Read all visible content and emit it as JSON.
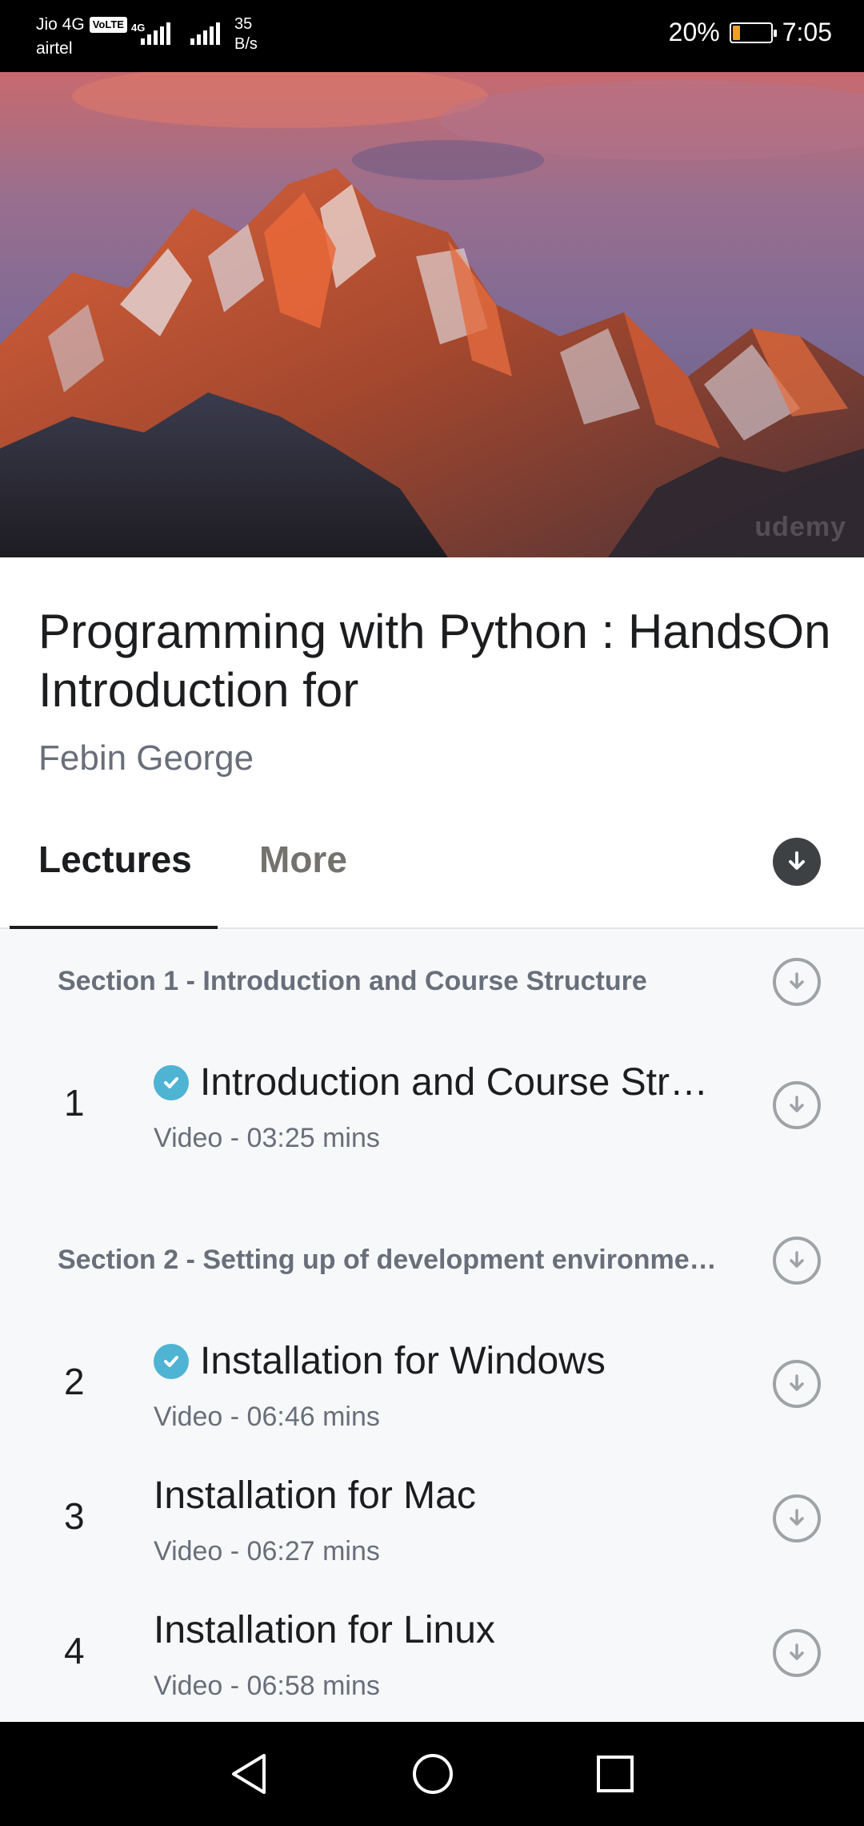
{
  "status_bar": {
    "carrier1": "Jio 4G",
    "volte": "VoLTE",
    "carrier2": "airtel",
    "network_type": "4G",
    "speed_value": "35",
    "speed_unit": "B/s",
    "battery": "20%",
    "time": "7:05",
    "battery_level_percent": 20,
    "battery_color": "#f0a020"
  },
  "hero": {
    "watermark": "udemy"
  },
  "course": {
    "title": "Programming with Python : HandsOn Introduction for",
    "instructor": "Febin George"
  },
  "tabs": {
    "lectures": "Lectures",
    "more": "More"
  },
  "sections": [
    {
      "title": "Section 1 - Introduction and Course Structure",
      "lectures": [
        {
          "number": "1",
          "title": "Introduction and Course Stru…",
          "meta": "Video - 03:25 mins",
          "completed": true
        }
      ]
    },
    {
      "title": "Section 2 - Setting up of development environmen…",
      "lectures": [
        {
          "number": "2",
          "title": "Installation for Windows",
          "meta": "Video - 06:46 mins",
          "completed": true
        },
        {
          "number": "3",
          "title": "Installation for Mac",
          "meta": "Video - 06:27 mins",
          "completed": false
        },
        {
          "number": "4",
          "title": "Installation for Linux",
          "meta": "Video - 06:58 mins",
          "completed": false
        }
      ]
    }
  ],
  "colors": {
    "accent_check": "#4fb3d3",
    "text_primary": "#1c1d1f",
    "text_secondary": "#686f7a"
  }
}
